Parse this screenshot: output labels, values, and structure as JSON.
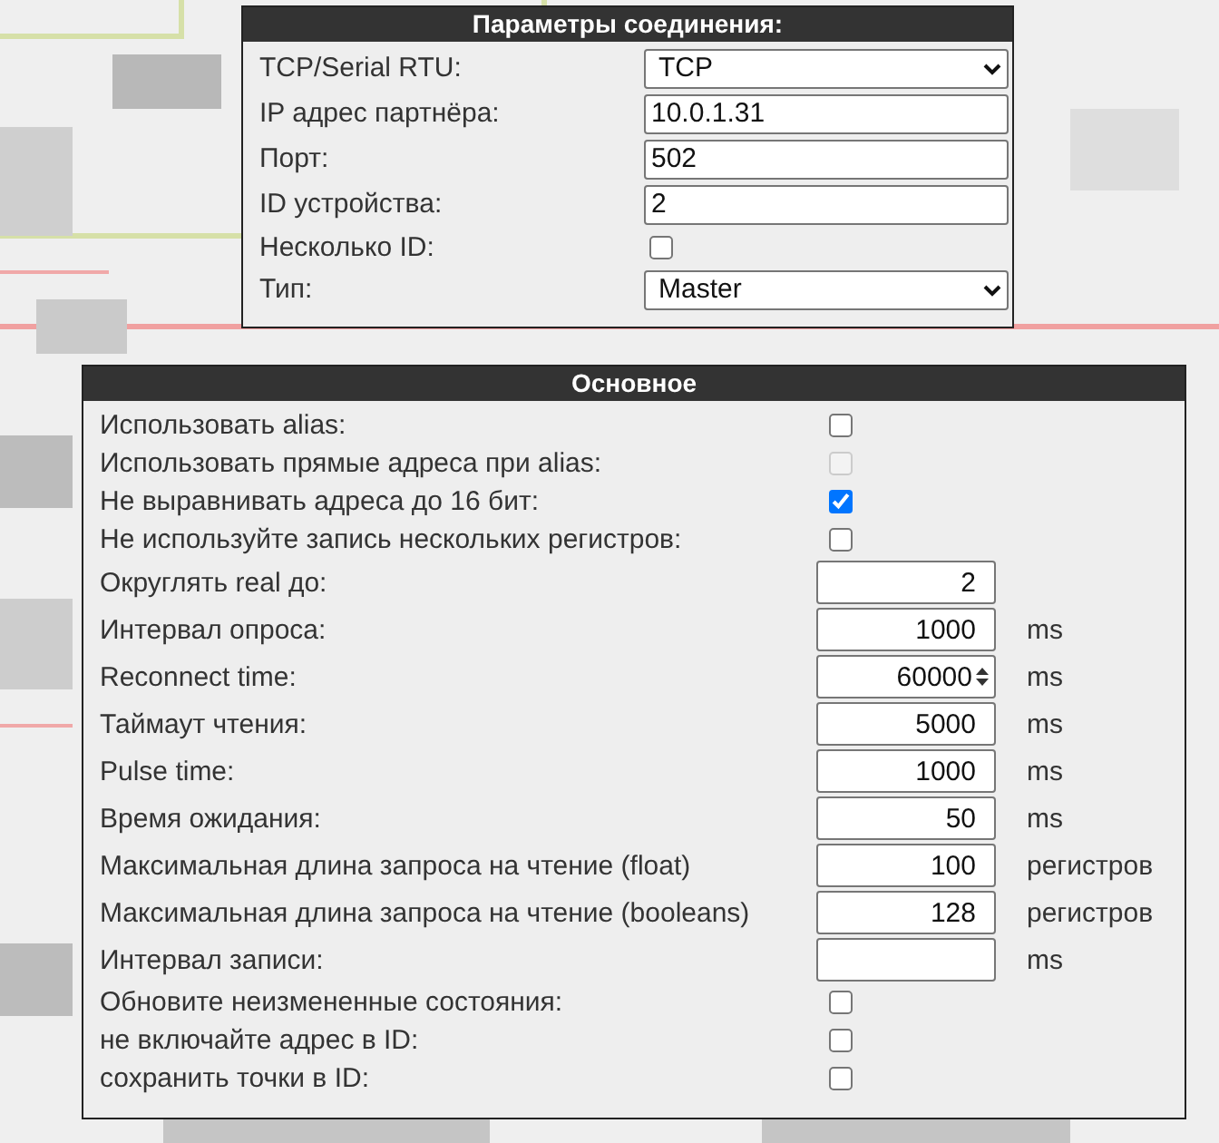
{
  "connection": {
    "title": "Параметры соединения:",
    "rows": [
      {
        "kind": "select",
        "label": "TCP/Serial RTU:",
        "value": "TCP"
      },
      {
        "kind": "text",
        "label": "IP адрес партнёра:",
        "value": "10.0.1.31"
      },
      {
        "kind": "text",
        "label": "Порт:",
        "value": "502"
      },
      {
        "kind": "text",
        "label": "ID устройства:",
        "value": "2"
      },
      {
        "kind": "checkbox",
        "label": "Несколько ID:",
        "checked": false,
        "disabled": false
      },
      {
        "kind": "select",
        "label": "Тип:",
        "value": "Master"
      }
    ]
  },
  "main": {
    "title": "Основное",
    "rows": [
      {
        "kind": "checkbox",
        "label": "Использовать alias:",
        "checked": false,
        "disabled": false
      },
      {
        "kind": "checkbox",
        "label": "Использовать прямые адреса при alias:",
        "checked": false,
        "disabled": true
      },
      {
        "kind": "checkbox",
        "label": "Не выравнивать адреса до 16 бит:",
        "checked": true,
        "disabled": false
      },
      {
        "kind": "checkbox",
        "label": "Не используйте запись нескольких регистров:",
        "checked": false,
        "disabled": false
      },
      {
        "kind": "number",
        "label": "Округлять real до:",
        "value": "2"
      },
      {
        "kind": "number",
        "label": "Интервал опроса:",
        "value": "1000",
        "unit": "ms"
      },
      {
        "kind": "spin",
        "label": "Reconnect time:",
        "value": "60000",
        "unit": "ms"
      },
      {
        "kind": "number",
        "label": "Таймаут чтения:",
        "value": "5000",
        "unit": "ms"
      },
      {
        "kind": "number",
        "label": "Pulse time:",
        "value": "1000",
        "unit": "ms"
      },
      {
        "kind": "number",
        "label": "Время ожидания:",
        "value": "50",
        "unit": "ms"
      },
      {
        "kind": "number",
        "label": "Максимальная длина запроса на чтение (float)",
        "value": "100",
        "unit": "регистров"
      },
      {
        "kind": "number",
        "label": "Максимальная длина запроса на чтение (booleans)",
        "value": "128",
        "unit": "регистров"
      },
      {
        "kind": "number",
        "label": "Интервал записи:",
        "unit": "ms"
      },
      {
        "kind": "checkbox",
        "label": "Обновите неизмененные состояния:",
        "checked": false,
        "disabled": false
      },
      {
        "kind": "checkbox",
        "label": "не включайте адрес в ID:",
        "checked": false,
        "disabled": false
      },
      {
        "kind": "checkbox",
        "label": "сохранить точки в ID:",
        "checked": false,
        "disabled": false
      }
    ]
  }
}
